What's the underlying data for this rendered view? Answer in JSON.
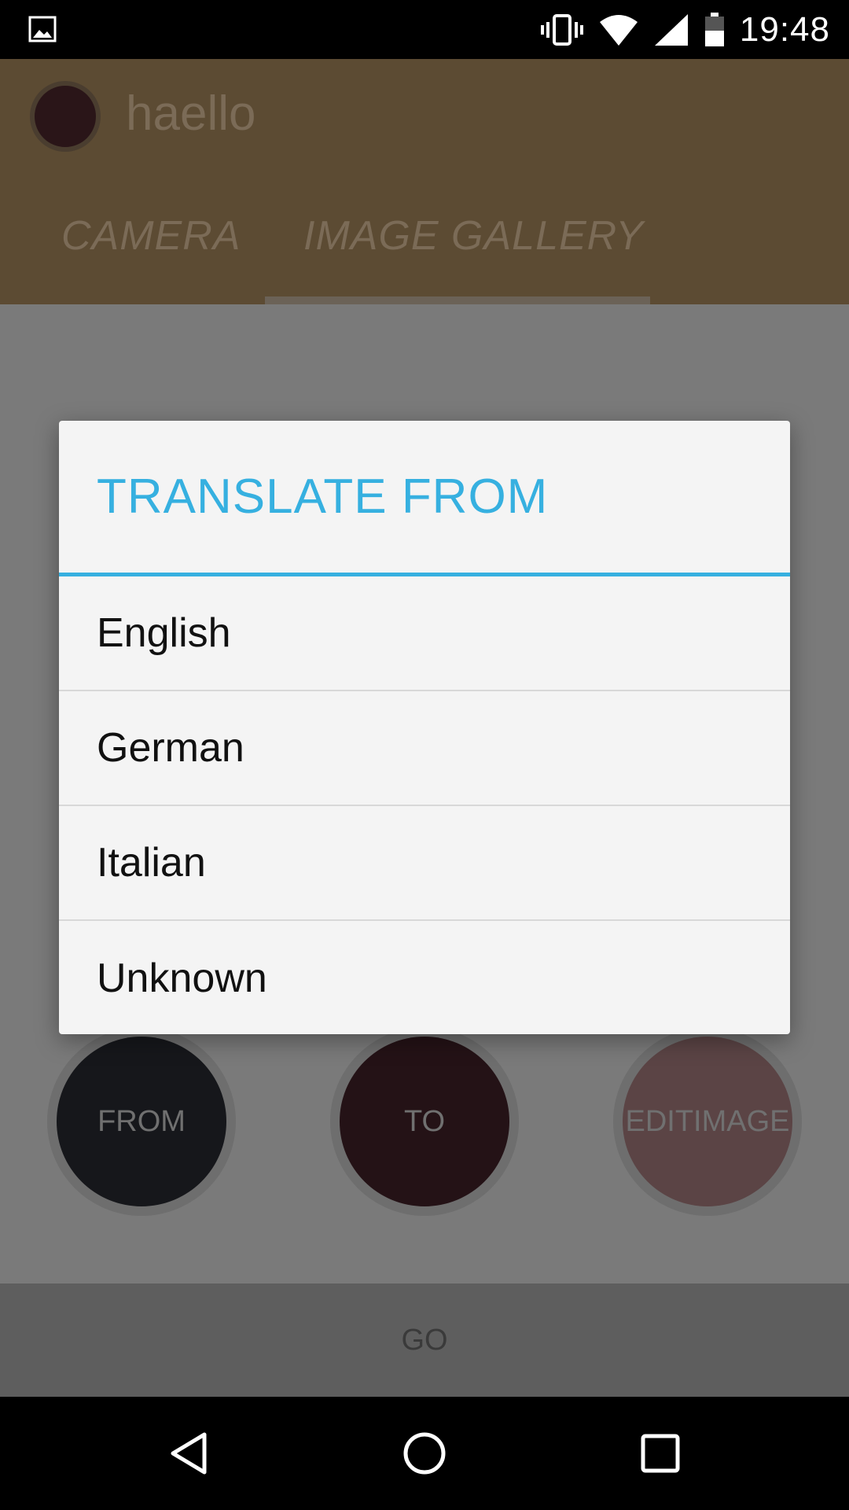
{
  "status_bar": {
    "time": "19:48",
    "icons": [
      "gallery-notification-icon",
      "vibrate-icon",
      "wifi-icon",
      "signal-icon",
      "battery-icon"
    ]
  },
  "app_bar": {
    "title": "haello",
    "tabs": [
      {
        "label": "CAMERA",
        "selected": false
      },
      {
        "label": "IMAGE GALLERY",
        "selected": true
      }
    ]
  },
  "buttons": {
    "from": "FROM",
    "to": "TO",
    "edit_line1": "EDIT",
    "edit_line2": "IMAGE",
    "go": "GO"
  },
  "dialog": {
    "title": "TRANSLATE FROM",
    "options": [
      "English",
      "German",
      "Italian",
      "Unknown"
    ]
  },
  "nav_bar": {
    "icons": [
      "back-icon",
      "home-icon",
      "recent-apps-icon"
    ]
  },
  "colors": {
    "accent": "#36b0e0",
    "app_bar": "#5c4b33",
    "scrim": "#7a7a7a"
  }
}
